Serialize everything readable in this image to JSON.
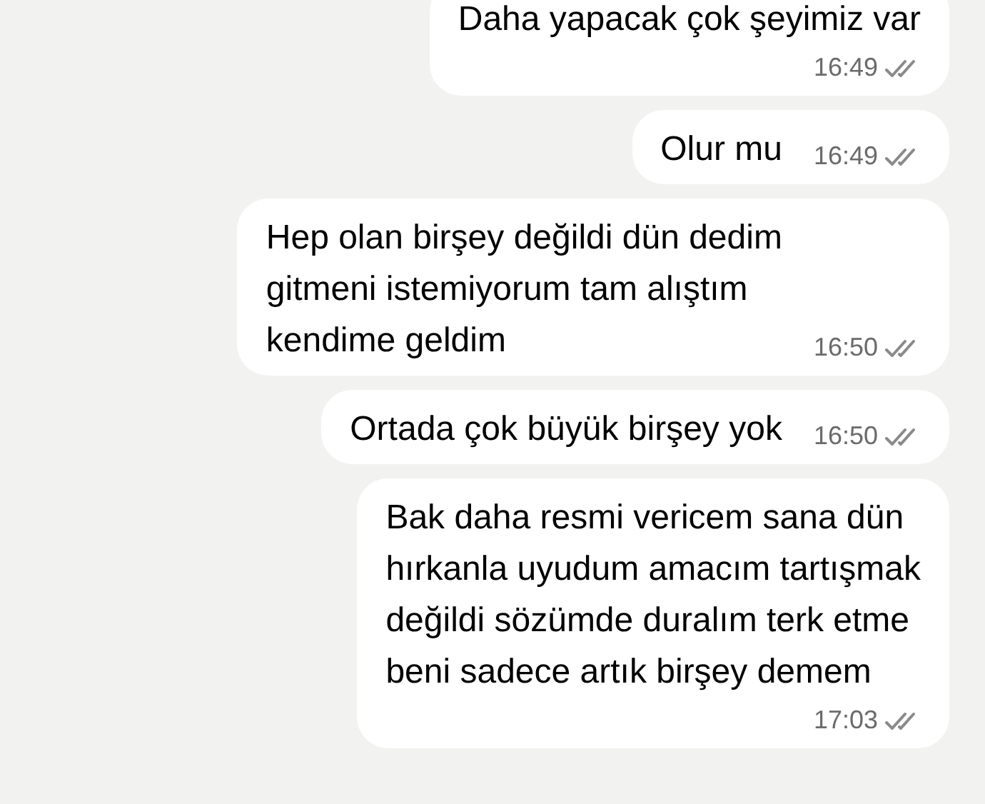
{
  "messages": [
    {
      "kind": "stacked",
      "text": "Daha yapacak çok şeyimiz var",
      "time": "16:49",
      "read": false
    },
    {
      "kind": "inline",
      "text": "Olur mu",
      "time": "16:49",
      "read": false
    },
    {
      "kind": "inline",
      "text": "Hep olan birşey değildi dün dedim\ngitmeni istemiyorum tam alıştım\nkendime geldim",
      "time": "16:50",
      "read": false
    },
    {
      "kind": "inline",
      "text": "Ortada çok büyük birşey yok",
      "time": "16:50",
      "read": false
    },
    {
      "kind": "stacked",
      "text": "Bak daha resmi vericem sana dün\nhırkanla uyudum amacım tartışmak\ndeğildi sözümde duralım terk etme\nbeni sadece artık birşey demem",
      "time": "17:03",
      "read": false
    }
  ]
}
